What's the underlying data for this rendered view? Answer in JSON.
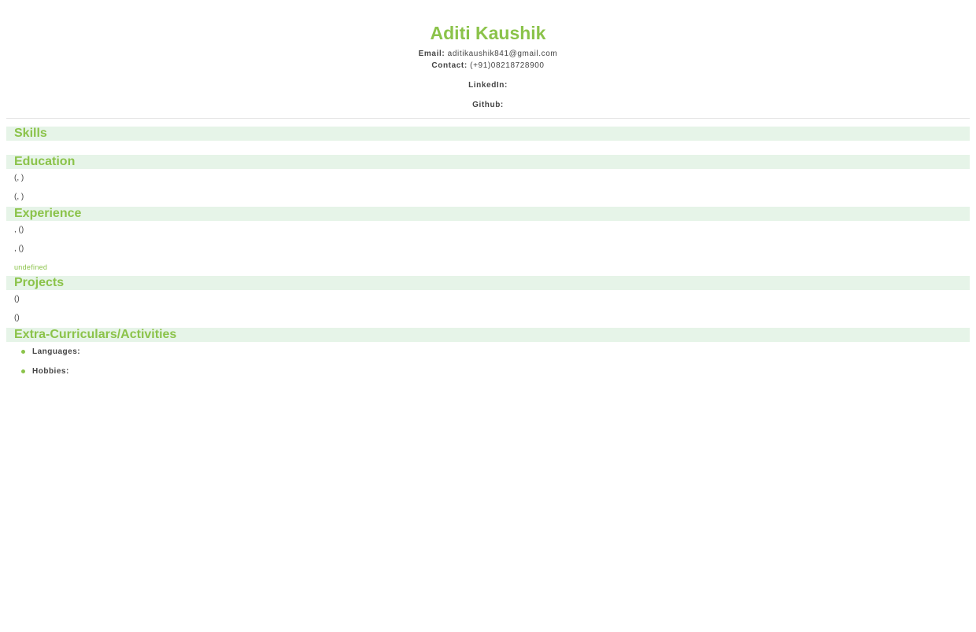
{
  "header": {
    "name": "Aditi Kaushik",
    "email_label": "Email:",
    "email_value": "aditikaushik841@gmail.com",
    "contact_label": "Contact:",
    "contact_value": "(+91)08218728900",
    "linkedin_label": "LinkedIn:",
    "github_label": "Github:"
  },
  "sections": {
    "skills": {
      "title": "Skills"
    },
    "education": {
      "title": "Education",
      "entries": [
        "(, )",
        "(, )"
      ]
    },
    "experience": {
      "title": "Experience",
      "entries": [
        ", ()",
        ", ()"
      ],
      "note": "undefined"
    },
    "projects": {
      "title": "Projects",
      "entries": [
        "()",
        "()"
      ]
    },
    "activities": {
      "title": "Extra-Curriculars/Activities",
      "items": [
        "Languages:",
        "Hobbies:"
      ]
    }
  },
  "colors": {
    "accent": "#8bc34a",
    "section_bg": "#e6f4e8",
    "text": "#444444"
  }
}
